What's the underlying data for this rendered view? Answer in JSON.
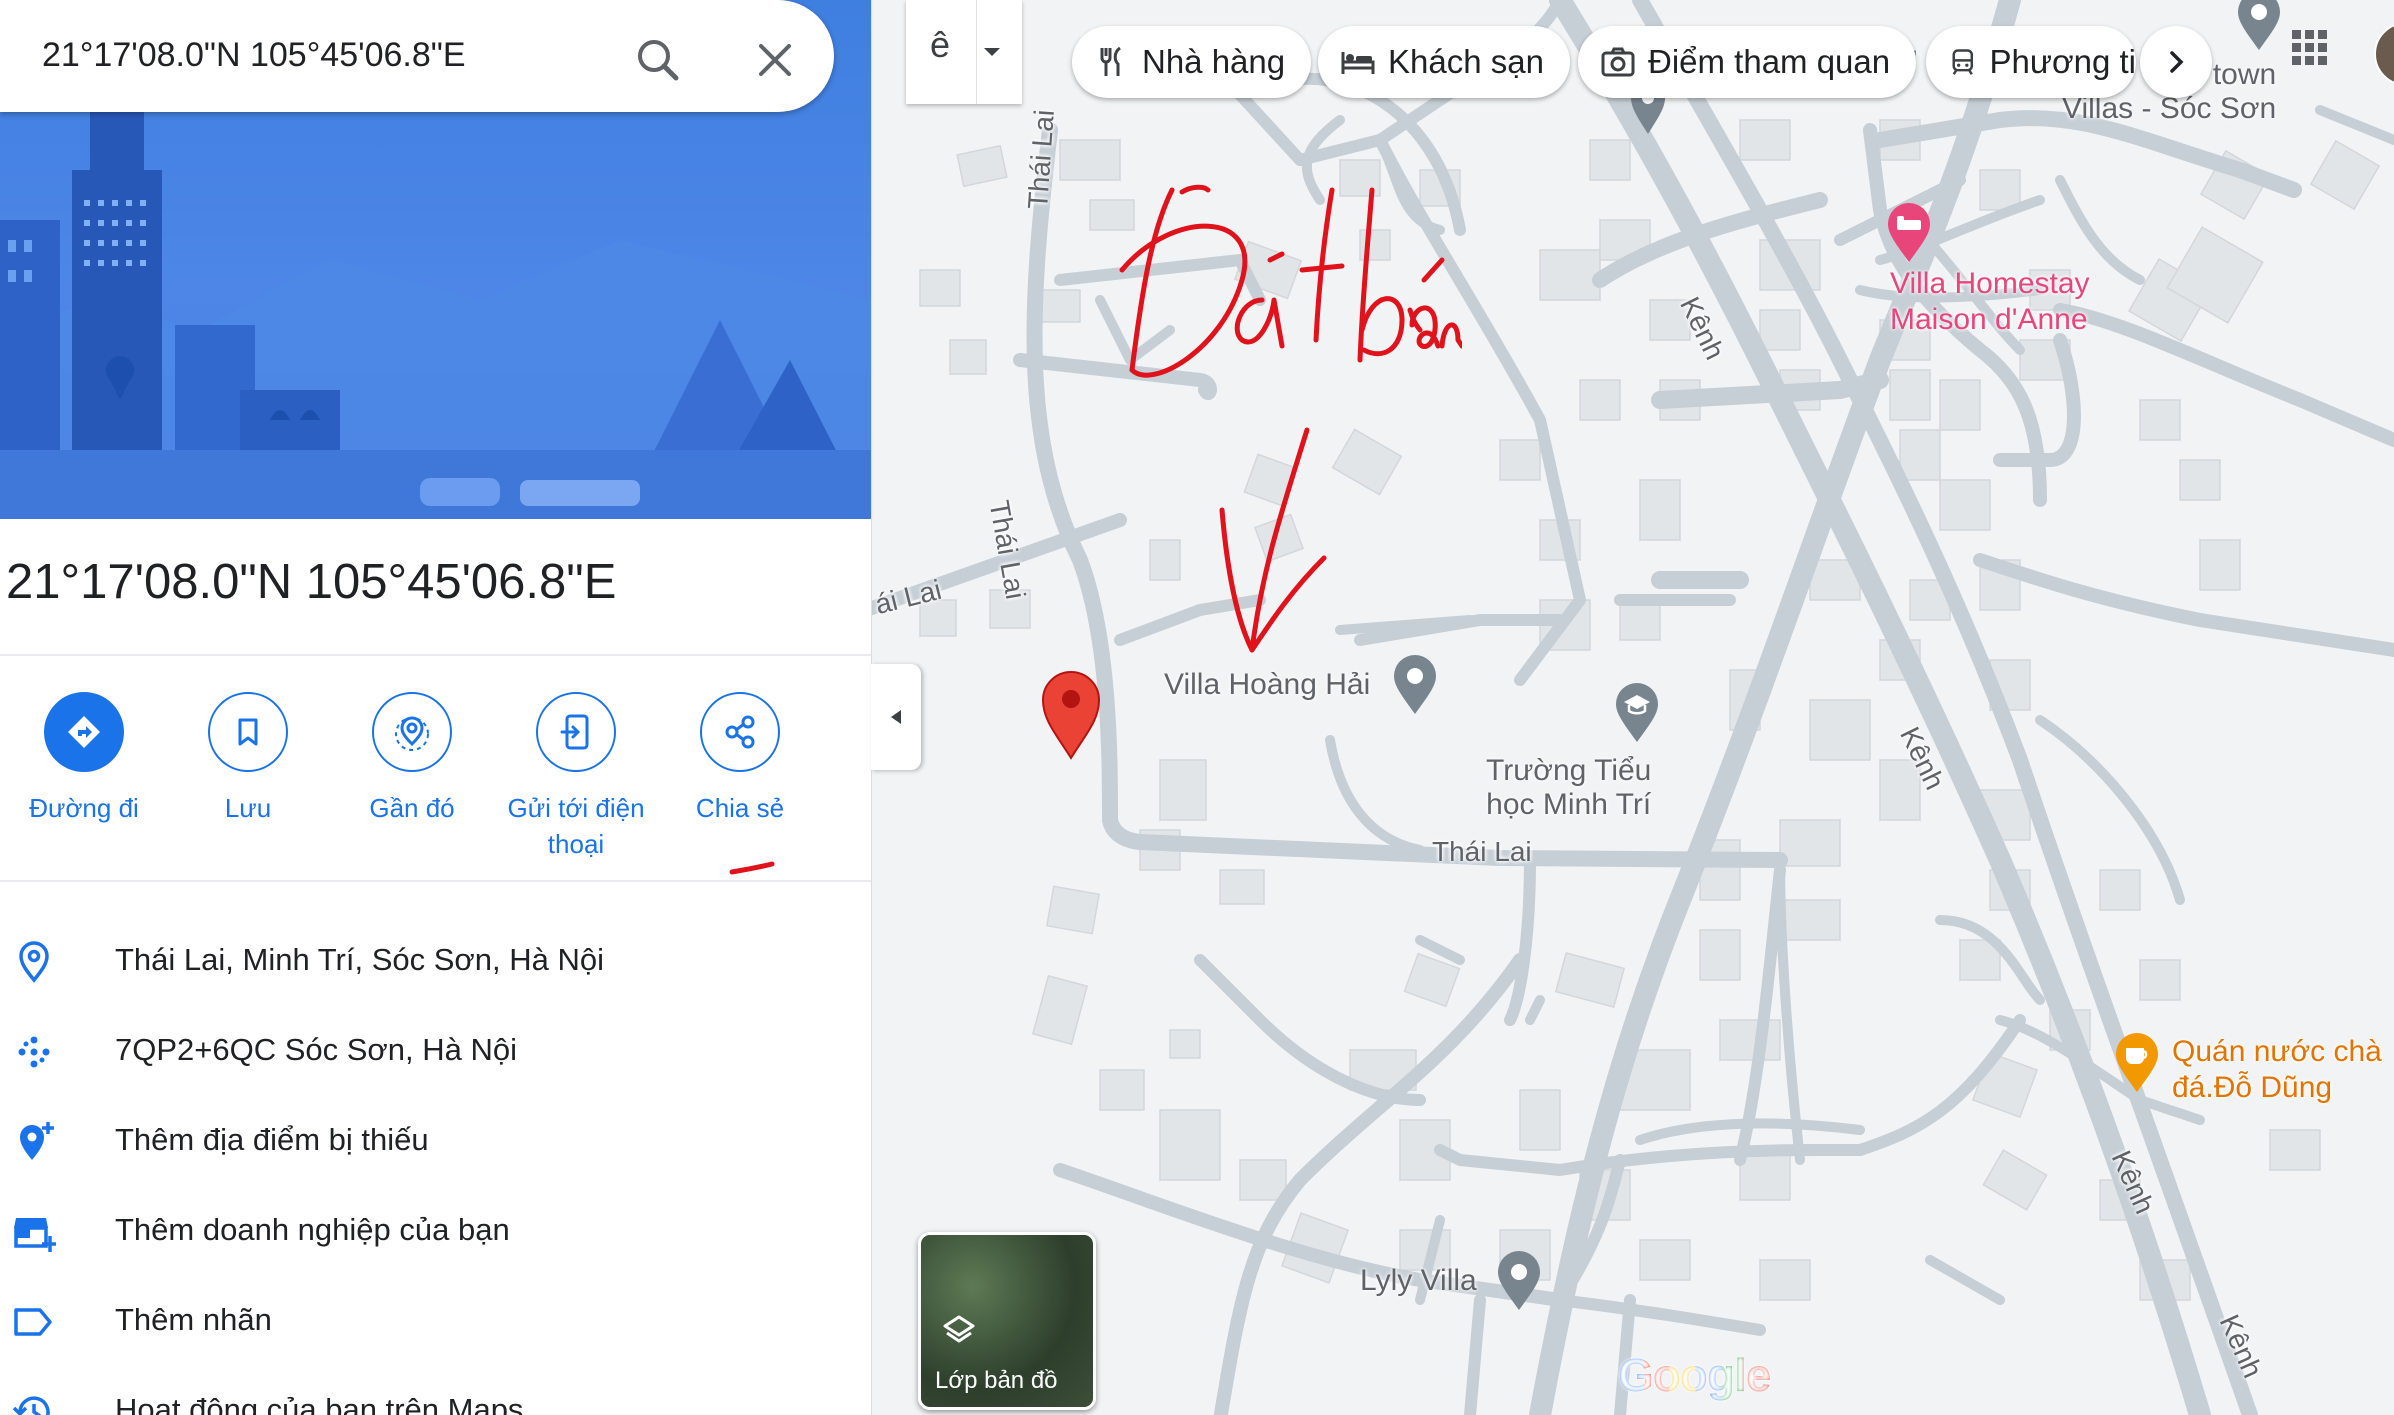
{
  "search": {
    "query": "21°17'08.0\"N 105°45'06.8\"E"
  },
  "place": {
    "title": "21°17'08.0\"N 105°45'06.8\"E"
  },
  "actions": [
    {
      "label": "Đường đi",
      "icon": "directions-icon"
    },
    {
      "label": "Lưu",
      "icon": "bookmark-icon"
    },
    {
      "label": "Gần đó",
      "icon": "nearby-icon"
    },
    {
      "label": "Gửi tới điện thoại",
      "icon": "send-to-phone-icon"
    },
    {
      "label": "Chia sẻ",
      "icon": "share-icon"
    }
  ],
  "info": [
    {
      "text": "Thái Lai, Minh Trí, Sóc Sơn, Hà Nội",
      "icon": "location-pin-icon"
    },
    {
      "text": "7QP2+6QC Sóc Sơn, Hà Nội",
      "icon": "plus-code-icon"
    },
    {
      "text": "Thêm địa điểm bị thiếu",
      "icon": "add-place-icon"
    },
    {
      "text": "Thêm doanh nghiệp của bạn",
      "icon": "add-business-icon"
    },
    {
      "text": "Thêm nhãn",
      "icon": "label-icon"
    },
    {
      "text": "Hoạt động của bạn trên Maps",
      "icon": "history-icon"
    }
  ],
  "chips": [
    {
      "label": "Nhà hàng",
      "icon": "restaurant-icon"
    },
    {
      "label": "Khách sạn",
      "icon": "hotel-icon"
    },
    {
      "label": "Điểm tham quan",
      "icon": "camera-icon"
    },
    {
      "label": "Phương ti",
      "icon": "transit-icon"
    }
  ],
  "input_tool": {
    "label": "ê"
  },
  "map": {
    "roads": {
      "thai_lai_1": "Thái Lai",
      "thai_lai_2": "Thái Lai",
      "thai_lai_3": "ái Lai",
      "thai_lai_4": "Thái Lai",
      "kenh_1": "Kênh",
      "kenh_2": "Kênh",
      "kenh_3": "Kênh",
      "kenh_4": "Kênh",
      "g_fragment": "g"
    },
    "pois": {
      "villa_hoang_hai": "Villa Hoàng Hải",
      "truong_tieu_hoc": "Trường Tiểu\nhọc Minh Trí",
      "villa_homestay": "Villa Homestay\nMaison d'Anne",
      "quan_nuoc": "Quán nước chà\nđá.Đỗ Dũng",
      "lyly_villa": "Lyly Villa",
      "town_villas": "town\nVillas - Sóc Sơn"
    },
    "annotation": "Đất bán",
    "layer_label": "Lớp bản đồ",
    "logo": "Google"
  },
  "colors": {
    "accent": "#1a73e8",
    "marker": "#ea4335",
    "annotation": "#e0121b",
    "pink_poi": "#e8457a",
    "orange_poi": "#e37400"
  }
}
